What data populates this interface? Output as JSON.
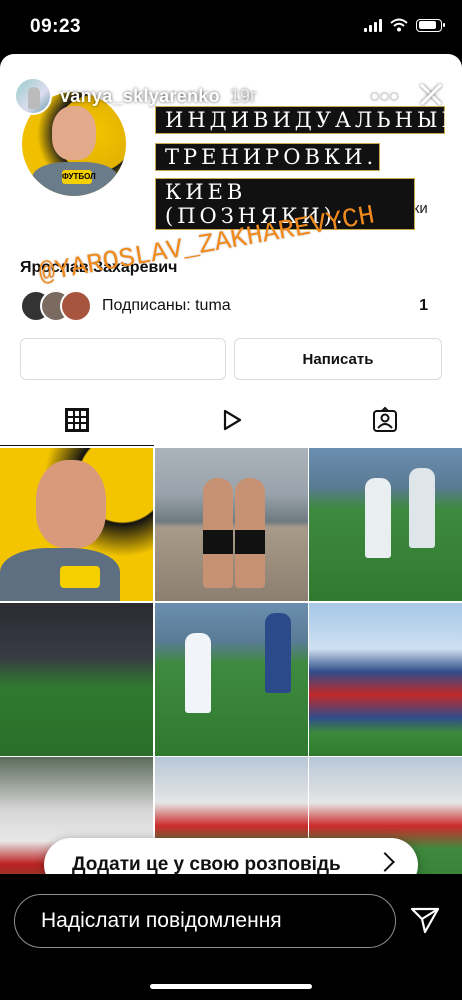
{
  "status_bar": {
    "time": "09:23",
    "battery_level": 0.85
  },
  "story": {
    "username": "vanya_sklyarenko",
    "age": "19г",
    "more": "•••",
    "progress": 0.25
  },
  "profile": {
    "obscured_stat": "дписки",
    "name": "Ярослав Захаревич",
    "followers_text": "Подписаны: tuma",
    "followers_count": "1",
    "follow_button": "",
    "message_button": "Написать"
  },
  "tabs": [
    "grid-icon",
    "reels-icon",
    "tagged-icon"
  ],
  "stickers": {
    "line1": "ИНДИВИДУАЛЬНЫЕ",
    "line2": "ТРЕНИРОВКИ.",
    "line3": "КИЕВ (ПОЗНЯКИ).",
    "handle": "@YAROSLAV_ZAKHAREVYCH"
  },
  "add_to_story": "Додати це у свою розповідь",
  "reply": {
    "placeholder": "Надіслати повідомлення"
  },
  "colors": {
    "handle": "#f08a1c",
    "sticker_bg": "#111111",
    "sticker_border": "#c9a94e"
  }
}
